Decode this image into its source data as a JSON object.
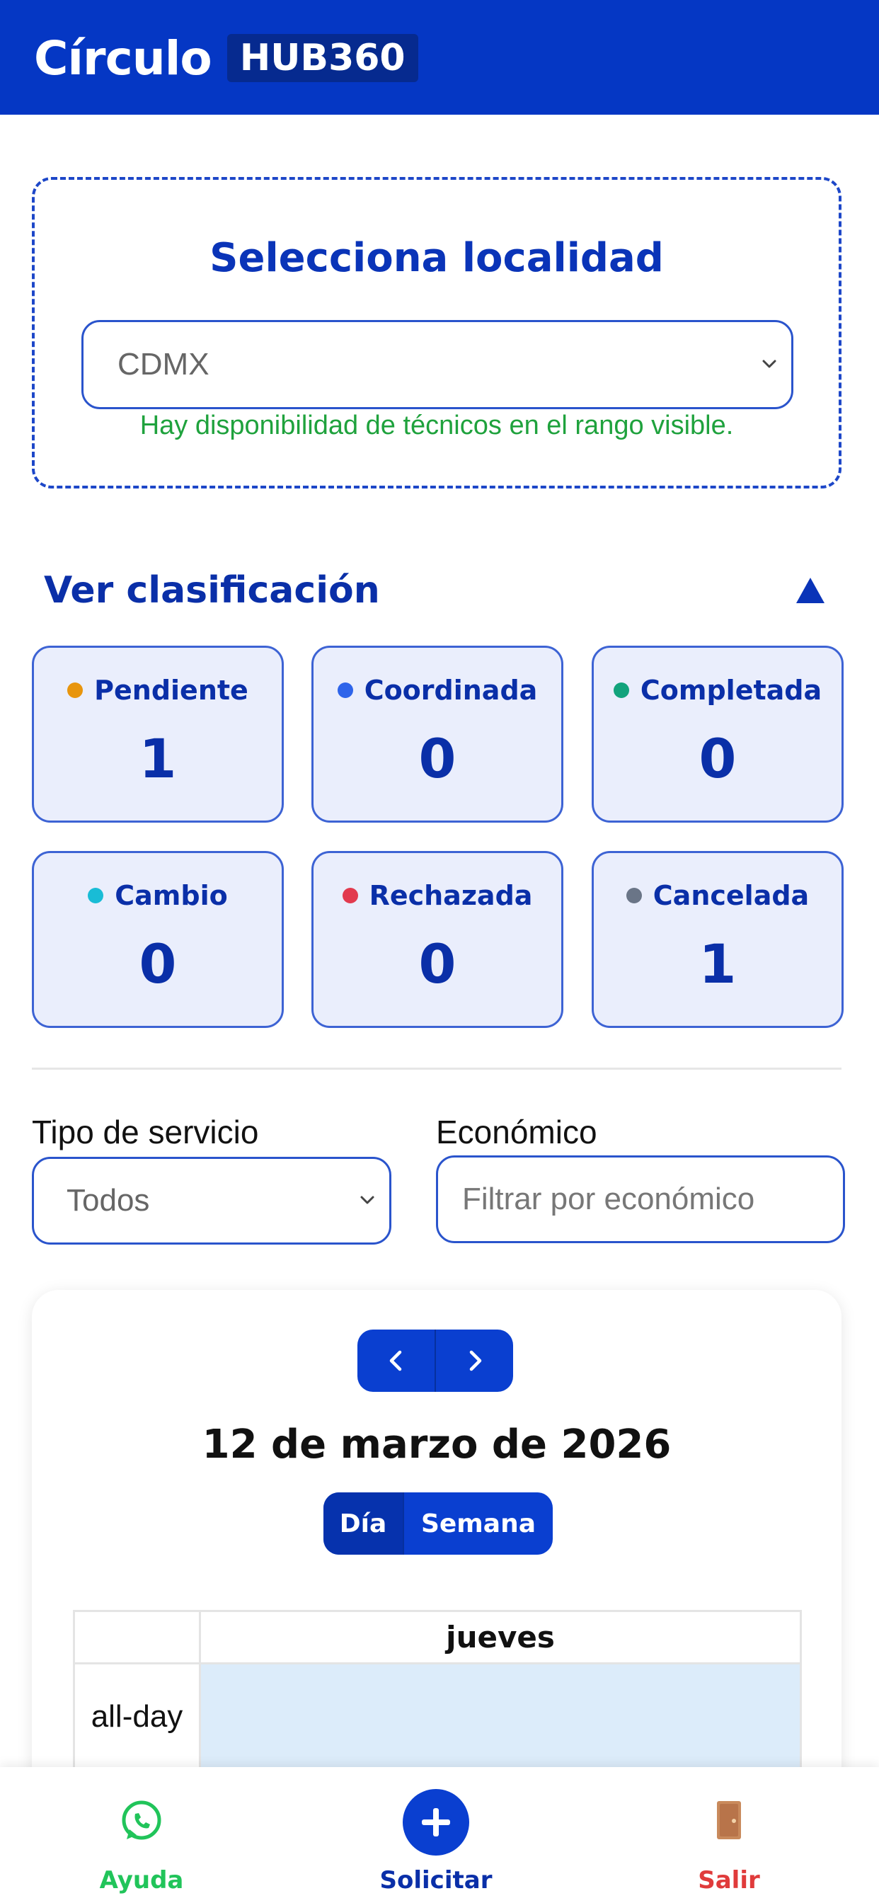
{
  "header": {
    "brand_name": "Círculo",
    "brand_badge": "HUB360"
  },
  "location": {
    "title": "Selecciona localidad",
    "selected": "CDMX",
    "message": "Hay disponibilidad de técnicos en el rango visible."
  },
  "classification": {
    "title": "Ver clasificación",
    "items": [
      {
        "label": "Pendiente",
        "value": "1",
        "dot_color": "#e8950d"
      },
      {
        "label": "Coordinada",
        "value": "0",
        "dot_color": "#2e64ea"
      },
      {
        "label": "Completada",
        "value": "0",
        "dot_color": "#12a37c"
      },
      {
        "label": "Cambio",
        "value": "0",
        "dot_color": "#19bcd6"
      },
      {
        "label": "Rechazada",
        "value": "0",
        "dot_color": "#e23a4e"
      },
      {
        "label": "Cancelada",
        "value": "1",
        "dot_color": "#6a7587"
      }
    ]
  },
  "filters": {
    "service_type_label": "Tipo de servicio",
    "service_type_selected": "Todos",
    "economic_label": "Económico",
    "economic_placeholder": "Filtrar por económico",
    "economic_value": ""
  },
  "calendar": {
    "date_title": "12 de marzo de 2026",
    "view_day": "Día",
    "view_week": "Semana",
    "column_day": "jueves",
    "allday_label": "all-day"
  },
  "bottom_nav": {
    "help": "Ayuda",
    "request": "Solicitar",
    "exit": "Salir"
  },
  "colors": {
    "brand_blue": "#0537c4",
    "help_green": "#21c45a",
    "exit_red": "#e03b3b"
  }
}
